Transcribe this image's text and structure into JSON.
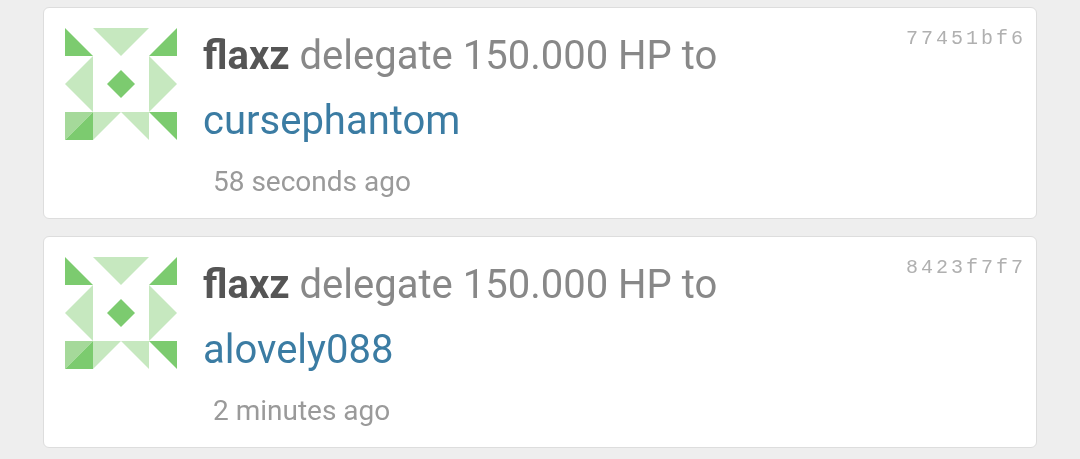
{
  "operations": [
    {
      "actor": "flaxz",
      "action": "delegate 150.000 HP to",
      "target": "cursephantom",
      "time": "58 seconds ago",
      "hash": "77451bf6"
    },
    {
      "actor": "flaxz",
      "action": "delegate 150.000 HP to",
      "target": "alovely088",
      "time": "2 minutes ago",
      "hash": "8423f7f7"
    }
  ]
}
